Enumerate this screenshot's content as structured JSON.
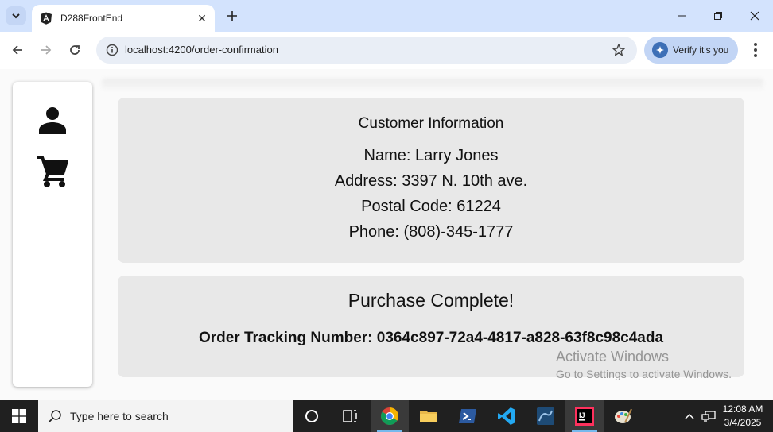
{
  "browser": {
    "tab_title": "D288FrontEnd",
    "url": "localhost:4200/order-confirmation",
    "profile_label": "Verify it's you",
    "close_tab_glyph": "✕",
    "new_tab_glyph": "+"
  },
  "icons": {
    "tab_search": "chevron-down-icon",
    "favicon": "angular-icon",
    "back": "back-arrow-icon",
    "forward": "forward-arrow-icon",
    "reload": "reload-icon",
    "site_info": "info-icon",
    "bookmark": "star-icon",
    "sidebar": [
      "person-icon",
      "cart-icon"
    ]
  },
  "customer": {
    "heading": "Customer Information",
    "name": "Name: Larry Jones",
    "address": "Address: 3397 N. 10th ave.",
    "postal": "Postal Code: 61224",
    "phone": "Phone: (808)-345-1777"
  },
  "purchase": {
    "heading": "Purchase Complete!",
    "tracking": "Order Tracking Number: 0364c897-72a4-4817-a828-63f8c98c4ada"
  },
  "watermark": {
    "line1": "Activate Windows",
    "line2": "Go to Settings to activate Windows."
  },
  "taskbar": {
    "search_placeholder": "Type here to search",
    "time": "12:08 AM",
    "date": "3/4/2025"
  },
  "colors": {
    "tabstrip": "#d3e3fd",
    "card": "#e8e8e8",
    "taskbar": "#202020"
  }
}
